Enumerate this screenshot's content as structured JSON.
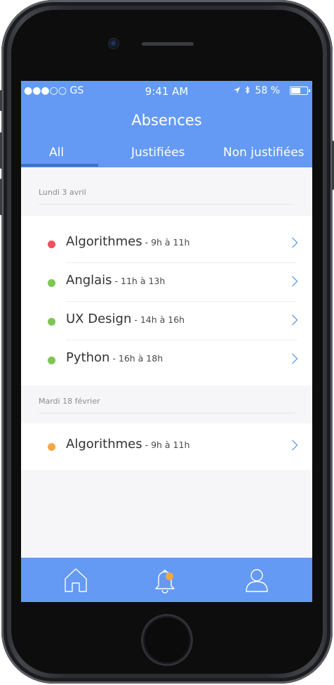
{
  "status_bar": {
    "carrier": "●●●○○ GS",
    "time": "9:41 AM",
    "battery": "58 %",
    "battery_level": 0.58
  },
  "header": {
    "title": "Absences",
    "tabs": [
      {
        "label": "All",
        "active": true
      },
      {
        "label": "Justifiées",
        "active": false
      },
      {
        "label": "Non justifiées",
        "active": false
      }
    ]
  },
  "sections": [
    {
      "date": "Lundi 3 avril",
      "items": [
        {
          "course": "Algorithmes",
          "time": " - 9h à 11h",
          "status_color": "#f2515a"
        },
        {
          "course": "Anglais",
          "time": " - 11h à 13h",
          "status_color": "#7dc653"
        },
        {
          "course": "UX Design",
          "time": " - 14h à 16h",
          "status_color": "#7dc653"
        },
        {
          "course": "Python",
          "time": " - 16h à 18h",
          "status_color": "#7dc653"
        }
      ]
    },
    {
      "date": "Mardi 18 février",
      "items": [
        {
          "course": "Algorithmes",
          "time": " - 9h à 11h",
          "status_color": "#f4a744"
        }
      ]
    }
  ],
  "tab_bar": {
    "icons": [
      "home-icon",
      "bell-icon",
      "profile-icon"
    ],
    "accent": "#649af3",
    "notification_color": "#f4a744"
  }
}
